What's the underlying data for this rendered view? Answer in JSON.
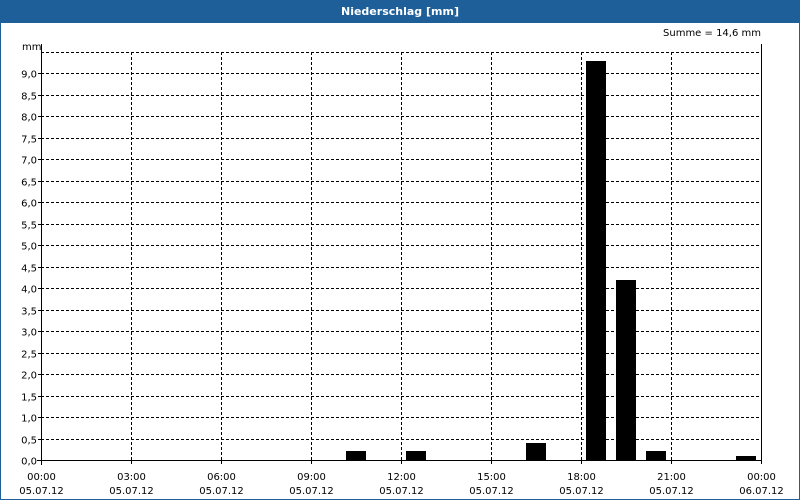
{
  "window": {
    "title": "Niederschlag [mm]"
  },
  "chart_data": {
    "type": "bar",
    "title": "Niederschlag [mm]",
    "summary": "Summe = 14,6 mm",
    "ylabel": "mm",
    "ylim": [
      0,
      9.3
    ],
    "ytick_values": [
      0,
      0.5,
      1.0,
      1.5,
      2.0,
      2.5,
      3.0,
      3.5,
      4.0,
      4.5,
      5.0,
      5.5,
      6.0,
      6.5,
      7.0,
      7.5,
      8.0,
      8.5,
      9.0
    ],
    "ytick_labels": [
      "0,0",
      "0,5",
      "1,0",
      "1,5",
      "2,0",
      "2,5",
      "3,0",
      "3,5",
      "4,0",
      "4,5",
      "5,0",
      "5,5",
      "6,0",
      "6,5",
      "7,0",
      "7,5",
      "8,0",
      "8,5",
      "9,0"
    ],
    "xlim_hours": [
      0,
      24
    ],
    "xticks": [
      {
        "hour": 0,
        "time": "00:00",
        "date": "05.07.12"
      },
      {
        "hour": 3,
        "time": "03:00",
        "date": "05.07.12"
      },
      {
        "hour": 6,
        "time": "06:00",
        "date": "05.07.12"
      },
      {
        "hour": 9,
        "time": "09:00",
        "date": "05.07.12"
      },
      {
        "hour": 12,
        "time": "12:00",
        "date": "05.07.12"
      },
      {
        "hour": 15,
        "time": "15:00",
        "date": "05.07.12"
      },
      {
        "hour": 18,
        "time": "18:00",
        "date": "05.07.12"
      },
      {
        "hour": 21,
        "time": "21:00",
        "date": "05.07.12"
      },
      {
        "hour": 24,
        "time": "00:00",
        "date": "06.07.12"
      }
    ],
    "bar_hours": [
      10,
      12,
      16,
      18,
      19,
      20,
      23
    ],
    "values": [
      0.2,
      0.2,
      0.4,
      9.3,
      4.2,
      0.2,
      0.1
    ],
    "grid": true,
    "colors": {
      "bar": "#000000",
      "grid": "#000000",
      "title_bar": "#1e5f99"
    }
  }
}
